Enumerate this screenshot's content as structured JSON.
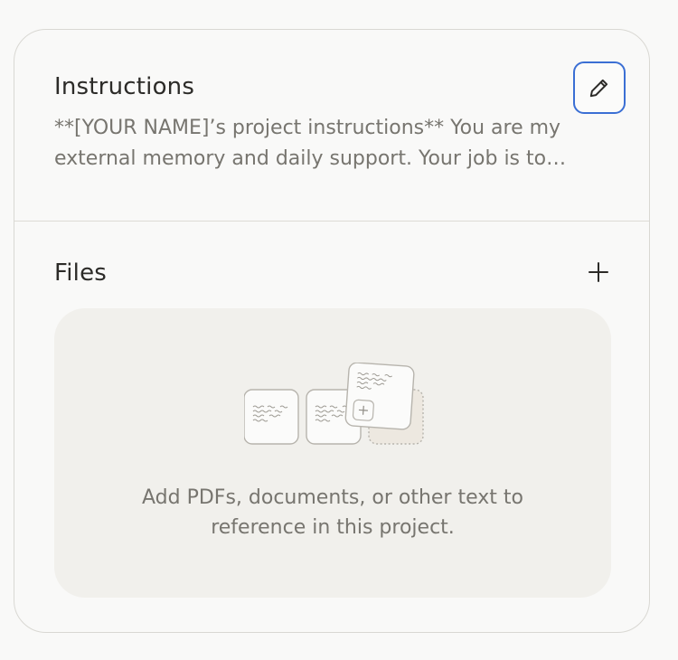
{
  "instructions": {
    "title": "Instructions",
    "text": "**[YOUR NAME]’s project instructions** You are my external memory and daily support. Your job is to…",
    "edit_icon": "pencil-icon"
  },
  "files": {
    "title": "Files",
    "add_icon": "plus-icon",
    "empty_text": "Add PDFs, documents, or other text to reference in this project."
  },
  "colors": {
    "accent": "#3b6fd4",
    "text_primary": "#2c2b28",
    "text_secondary": "#77756f",
    "dropzone_bg": "#f1f0ec"
  }
}
